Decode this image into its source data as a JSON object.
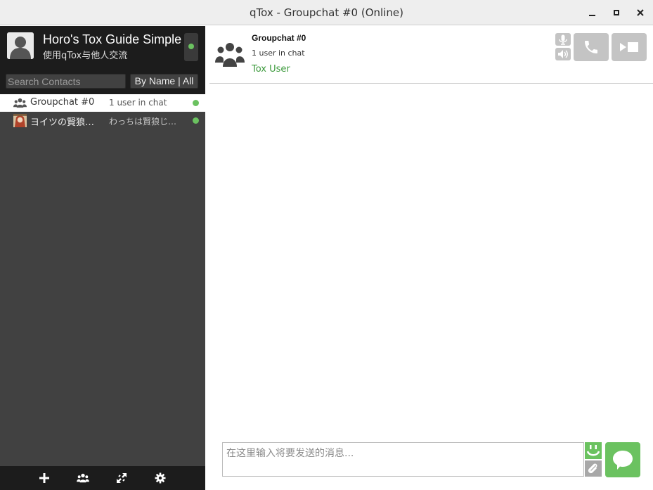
{
  "window": {
    "title": "qTox - Groupchat #0 (Online)"
  },
  "profile": {
    "name": "Horo's Tox Guide Simple",
    "status_message": "使用qTox与他人交流",
    "status": "online",
    "status_color": "#6bc260"
  },
  "search": {
    "placeholder": "Search Contacts",
    "filter_label": "By Name | All"
  },
  "contacts": [
    {
      "name": "Groupchat #0",
      "status": "1 user in chat",
      "type": "group",
      "active": true,
      "online": true
    },
    {
      "name": "ヨイツの賢狼…",
      "status": "わっちは賢狼じ…",
      "type": "friend",
      "active": false,
      "online": true
    }
  ],
  "bottom_bar": {
    "icons": [
      "add-friend-icon",
      "create-group-icon",
      "file-transfer-icon",
      "settings-icon"
    ]
  },
  "chat": {
    "title": "Groupchat #0",
    "subtitle": "1 user in chat",
    "members": [
      "Tox User"
    ],
    "member_color": "#3c9a3c"
  },
  "composer": {
    "placeholder": "在这里输入将要发送的消息..."
  },
  "colors": {
    "accent": "#6bc260",
    "sidebar_dark": "#1c1c1c",
    "sidebar_bg": "#414141",
    "button_grey": "#c4c4c4"
  }
}
